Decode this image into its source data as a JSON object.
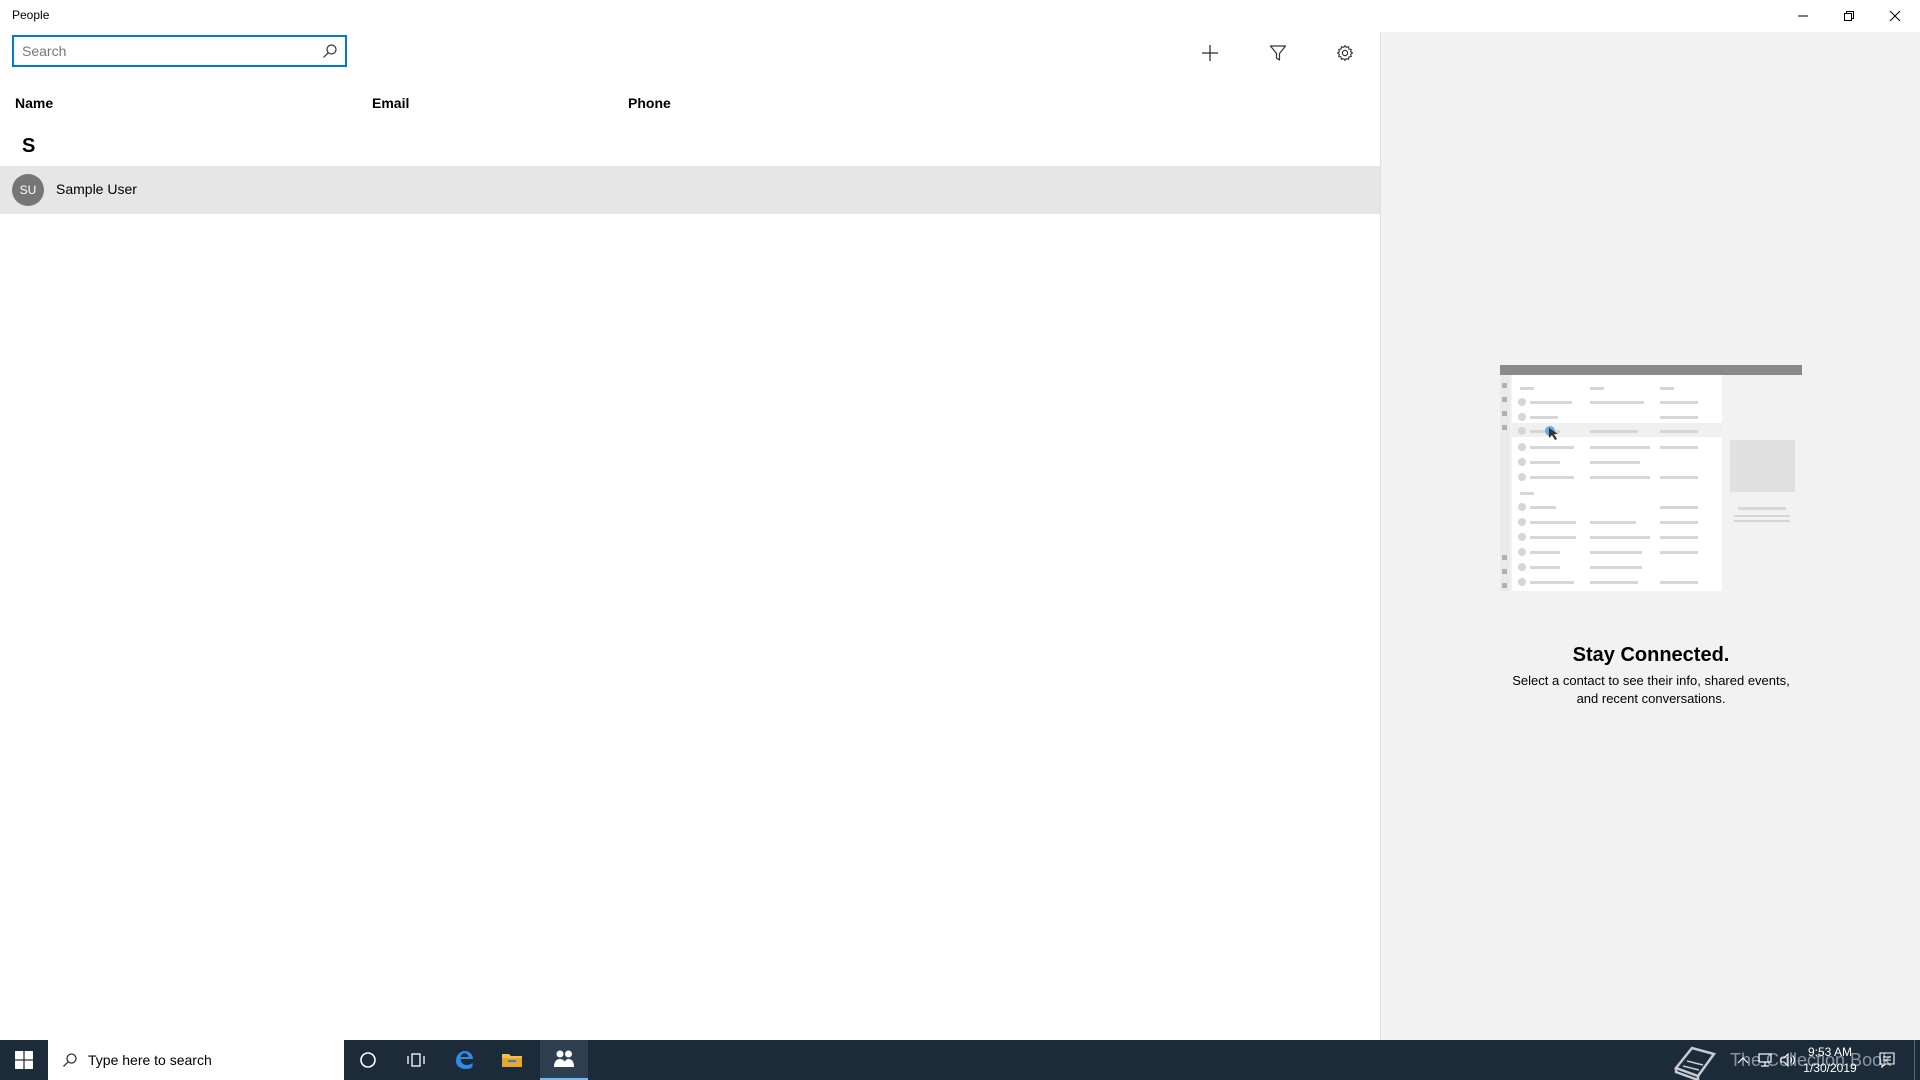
{
  "window": {
    "title": "People"
  },
  "toolbar": {
    "search_placeholder": "Search",
    "search_value": ""
  },
  "columns": [
    "Name",
    "Email",
    "Phone"
  ],
  "contacts": {
    "group_letter": "S",
    "items": [
      {
        "initials": "SU",
        "name": "Sample User"
      }
    ]
  },
  "detail": {
    "title": "Stay Connected.",
    "description_line1": "Select a contact to see their info, shared events,",
    "description_line2": "and recent conversations."
  },
  "taskbar": {
    "search_placeholder": "Type here to search",
    "time": "9:53 AM",
    "date": "1/30/2019",
    "watermark": "The Collection Book"
  },
  "colors": {
    "accent": "#0078d7",
    "taskbar_bg": "#1c2b3a",
    "detail_bg": "#f2f2f2",
    "selected_row": "#e6e6e6",
    "avatar": "#767676"
  }
}
